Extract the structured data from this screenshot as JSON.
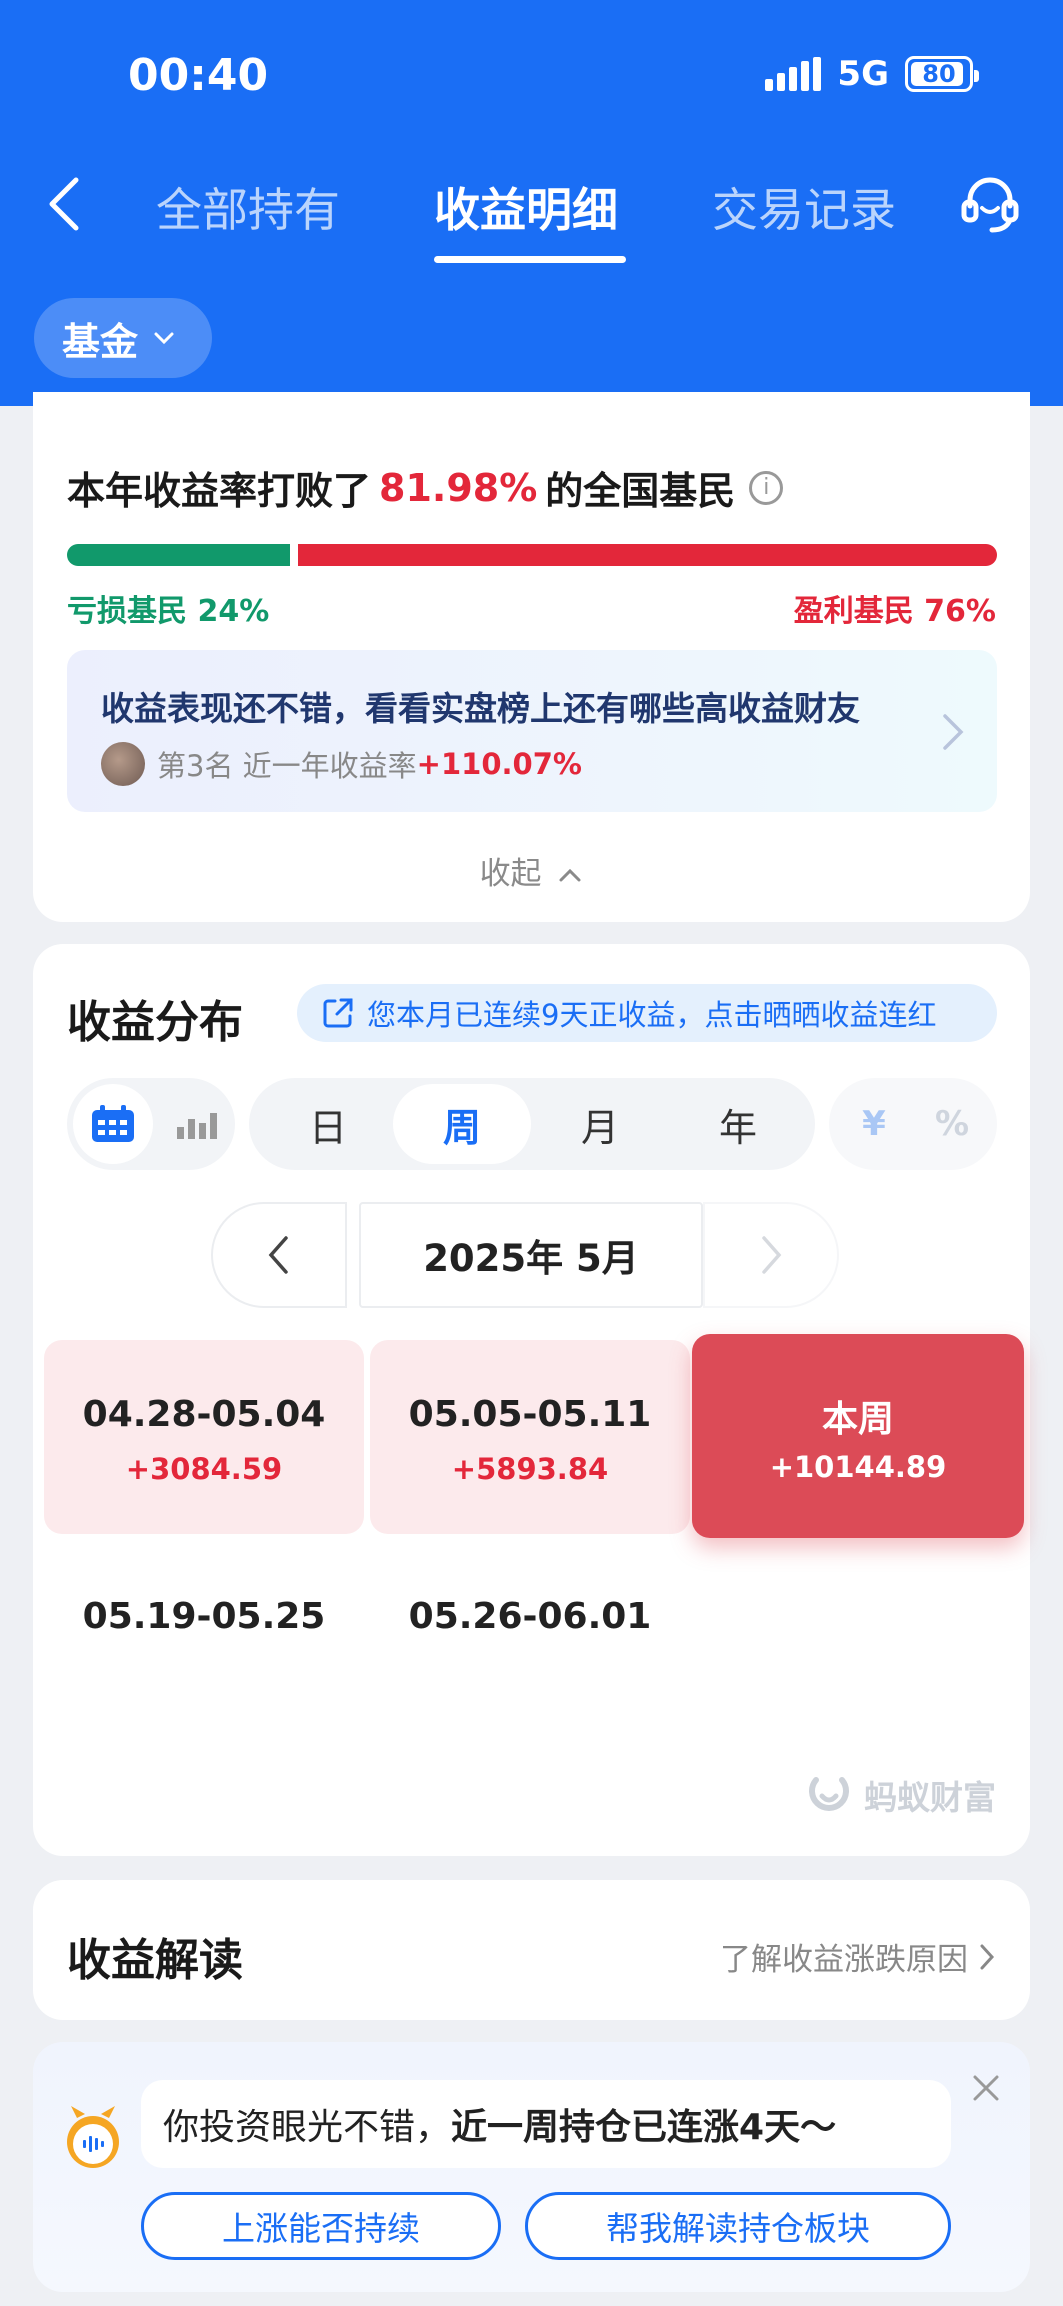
{
  "status_bar": {
    "time": "00:40",
    "network": "5G",
    "battery": "80"
  },
  "nav": {
    "tabs": [
      {
        "label": "全部持有"
      },
      {
        "label": "收益明细"
      },
      {
        "label": "交易记录"
      }
    ],
    "active_tab": 1
  },
  "filter": {
    "label": "基金"
  },
  "ranking": {
    "prefix": "本年收益率打败了",
    "percent": "81.98%",
    "suffix": "的全国基民",
    "loss_label": "亏损基民 24%",
    "gain_label": "盈利基民 76%",
    "loss_share": 0.24,
    "gain_share": 0.76,
    "colors": {
      "loss": "#11996b",
      "gain": "#e3273a"
    }
  },
  "promo": {
    "title": "收益表现还不错，看看实盘榜上还有哪些高收益财友",
    "sub_prefix": "第3名  近一年收益率",
    "sub_value": "+110.07%"
  },
  "collapse_label": "收起",
  "distribution": {
    "title": "收益分布",
    "streak_text": "您本月已连续9天正收益，点击晒晒收益连红",
    "periods": [
      "日",
      "周",
      "月",
      "年"
    ],
    "active_period": "周",
    "units": [
      "¥",
      "%"
    ],
    "active_unit": "¥",
    "month_label": "2025年 5月",
    "weeks": [
      {
        "range": "04.28-05.04",
        "value": "+3084.59"
      },
      {
        "range": "05.05-05.11",
        "value": "+5893.84"
      },
      {
        "range": "本周",
        "value": "+10144.89"
      },
      {
        "range": "05.19-05.25",
        "value": ""
      },
      {
        "range": "05.26-06.01",
        "value": ""
      }
    ],
    "watermark": "蚂蚁财富"
  },
  "interpretation": {
    "title": "收益解读",
    "link": "了解收益涨跌原因"
  },
  "assistant": {
    "message_plain": "你投资眼光不错，",
    "message_bold": "近一周持仓已连涨4天～",
    "buttons": [
      "上涨能否持续",
      "帮我解读持仓板块"
    ]
  },
  "colors": {
    "brand": "#1a6ef5",
    "gain": "#e3273a",
    "loss": "#11996b",
    "current_week": "#dc4b57"
  }
}
